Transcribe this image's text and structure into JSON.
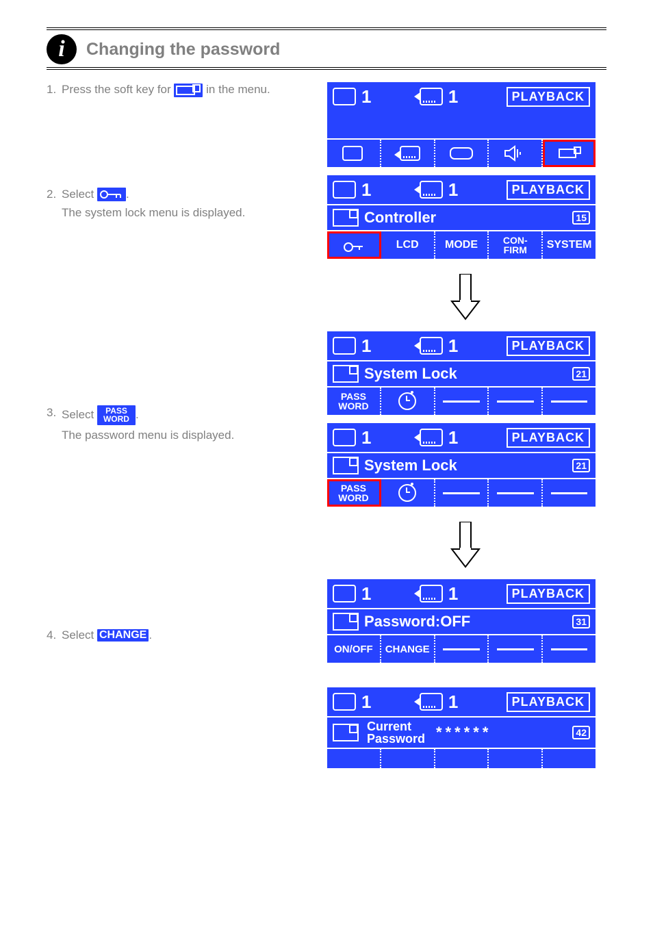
{
  "header": {
    "title": "Changing the password"
  },
  "steps": {
    "s1": {
      "prefix": "1.",
      "text_a": "Press the soft key for",
      "text_b": "in the menu."
    },
    "s2": {
      "prefix": "2.",
      "text": "Select",
      "text_suffix": ".",
      "sub": "The system lock menu is displayed."
    },
    "s3": {
      "prefix": "3.",
      "text": "Select",
      "text_suffix": ".",
      "sub": "The password menu is displayed."
    },
    "s4": {
      "prefix": "4.",
      "text": "Select",
      "text_suffix": "."
    }
  },
  "chips": {
    "password": "PASS\nWORD",
    "change": "CHANGE"
  },
  "status": {
    "monitor": "1",
    "camera": "1",
    "badge": "PLAYBACK"
  },
  "titles": {
    "controller": "Controller",
    "system_lock": "System Lock",
    "password": "Password:OFF",
    "current_password": "Current\nPassword"
  },
  "page_nums": {
    "controller": "15",
    "system_lock": "21",
    "password": "31",
    "current": "42"
  },
  "controller_tabs": {
    "lcd": "LCD",
    "mode": "MODE",
    "confirm": "CON-\nFIRM",
    "system": "SYSTEM"
  },
  "syslock_tabs": {
    "password": "PASS\nWORD"
  },
  "password_tabs": {
    "onoff": "ON/OFF",
    "change": "CHANGE"
  },
  "current_password_value": "******"
}
